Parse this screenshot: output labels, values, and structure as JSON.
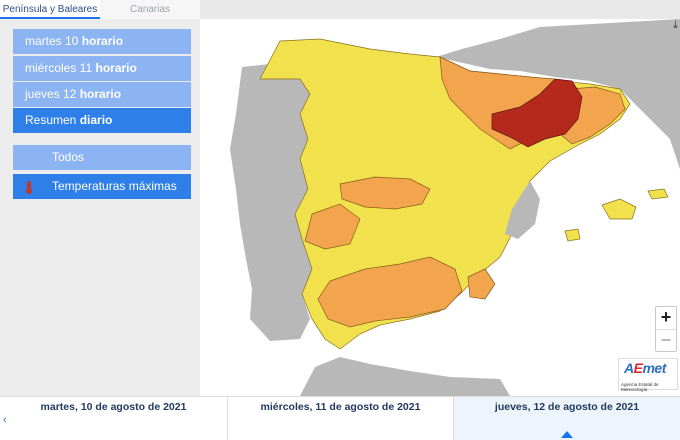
{
  "tabs": [
    "Península y Baleares",
    "Canarias"
  ],
  "forecast_buttons": [
    {
      "day": "martes 10",
      "suffix": "horario"
    },
    {
      "day": "miércoles 11",
      "suffix": "horario"
    },
    {
      "day": "jueves 12",
      "suffix": "horario"
    },
    {
      "day": "Resumen",
      "suffix": "diario"
    }
  ],
  "filters": [
    "Todos",
    "Temperaturas máximas"
  ],
  "zoom": {
    "in": "+",
    "out": "−"
  },
  "logo": {
    "brand_a": "A",
    "brand_e": "E",
    "brand_rest": "met",
    "subtitle": "Agencia Estatal de Meteorología"
  },
  "timeline": [
    "martes, 10 de agosto de 2021",
    "miércoles, 11 de agosto de 2021",
    "jueves, 12 de agosto de 2021"
  ],
  "icons": {
    "download": "download-icon",
    "thermometer": "thermometer-icon",
    "prev": "chevron-left-icon"
  },
  "colors": {
    "green_level": "#f1e24d",
    "orange_level": "#f2a54c",
    "red_level": "#b5291d",
    "outside": "#b8b8b8",
    "accent": "#2f7fe8"
  }
}
